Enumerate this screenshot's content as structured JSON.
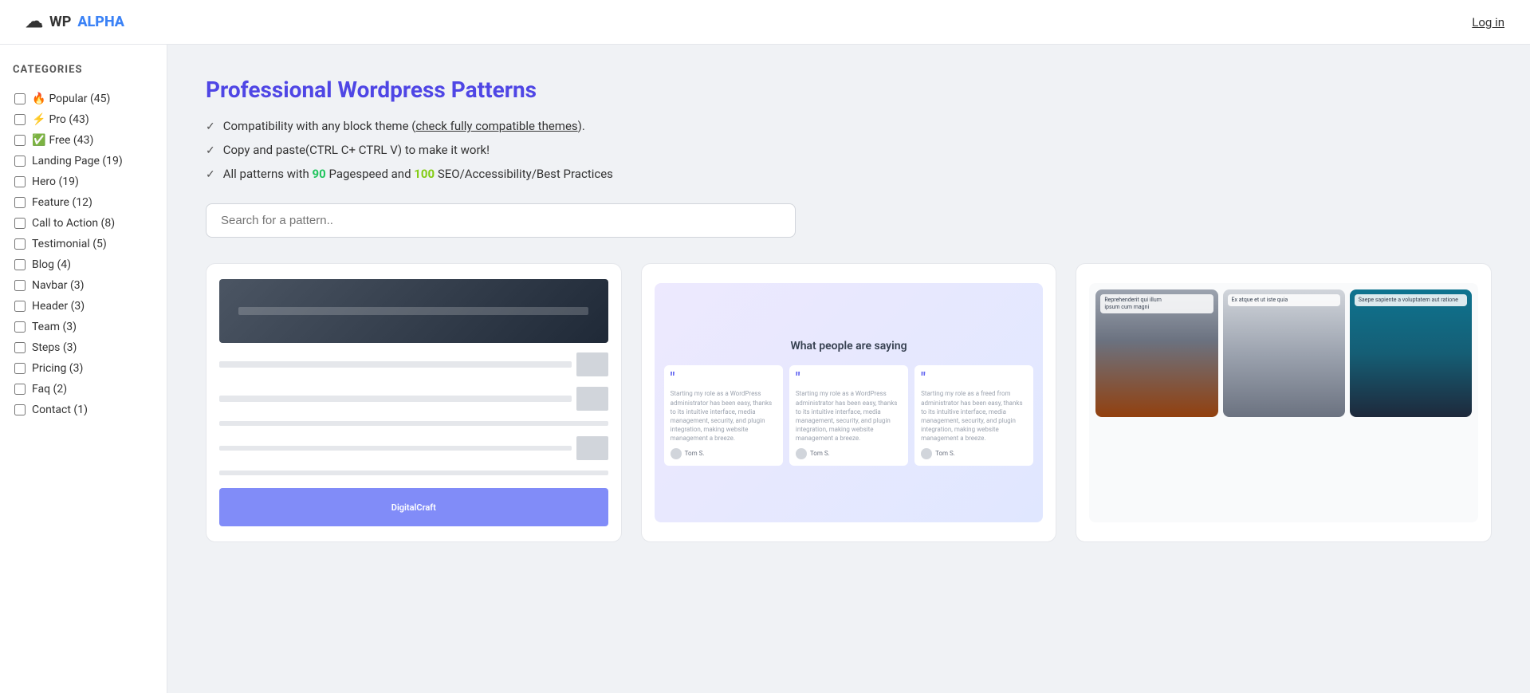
{
  "nav": {
    "logo_wp": "WP",
    "logo_alpha": "ALPHA",
    "login_label": "Log in"
  },
  "sidebar": {
    "title": "CATEGORIES",
    "items": [
      {
        "id": "popular",
        "icon": "🔥",
        "label": "Popular (45)",
        "checked": false
      },
      {
        "id": "pro",
        "icon": "⚡",
        "label": "Pro (43)",
        "checked": false
      },
      {
        "id": "free",
        "icon": "✅",
        "label": "Free (43)",
        "checked": false
      },
      {
        "id": "landing-page",
        "icon": "",
        "label": "Landing Page (19)",
        "checked": false
      },
      {
        "id": "hero",
        "icon": "",
        "label": "Hero (19)",
        "checked": false
      },
      {
        "id": "feature",
        "icon": "",
        "label": "Feature (12)",
        "checked": false
      },
      {
        "id": "cta",
        "icon": "",
        "label": "Call to Action (8)",
        "checked": false
      },
      {
        "id": "testimonial",
        "icon": "",
        "label": "Testimonial (5)",
        "checked": false
      },
      {
        "id": "blog",
        "icon": "",
        "label": "Blog (4)",
        "checked": false
      },
      {
        "id": "navbar",
        "icon": "",
        "label": "Navbar (3)",
        "checked": false
      },
      {
        "id": "header",
        "icon": "",
        "label": "Header (3)",
        "checked": false
      },
      {
        "id": "team",
        "icon": "",
        "label": "Team (3)",
        "checked": false
      },
      {
        "id": "steps",
        "icon": "",
        "label": "Steps (3)",
        "checked": false
      },
      {
        "id": "pricing",
        "icon": "",
        "label": "Pricing (3)",
        "checked": false
      },
      {
        "id": "faq",
        "icon": "",
        "label": "Faq (2)",
        "checked": false
      },
      {
        "id": "contact",
        "icon": "",
        "label": "Contact (1)",
        "checked": false
      }
    ]
  },
  "main": {
    "title": "Professional Wordpress Patterns",
    "features": [
      {
        "id": "compat",
        "text_before": "Compatibility with any block theme (",
        "link_text": "check fully compatible themes",
        "text_after": ")."
      },
      {
        "id": "copy",
        "text": "Copy and paste(CTRL C+ CTRL V) to make it work!"
      },
      {
        "id": "pagespeed",
        "text_before": "All patterns with ",
        "score1": "90",
        "text_middle": " Pagespeed and ",
        "score2": "100",
        "text_after": " SEO/Accessibility/Best Practices"
      }
    ],
    "search_placeholder": "Search for a pattern..",
    "cards": [
      {
        "id": "card-landing",
        "type": "landing-preview",
        "bottom_label": "DigitalCraft"
      },
      {
        "id": "card-testimonial",
        "type": "testimonial-preview",
        "title": "What people are saying",
        "quotes": [
          {
            "text": "Starting my role as a WordPress administrator has been easy, thanks to its intuitive interface, media management, security, and plugin integration, making website management a breeze.",
            "author": "Tom S."
          },
          {
            "text": "Starting my role as a WordPress administrator has been easy, thanks to its intuitive interface, media management, security, and plugin integration, making website management a breeze.",
            "author": "Tom S."
          },
          {
            "text": "Starting my role as a freed from administrator has been easy, thanks to its intuitive interface, media management, security, and plugin integration, making website management a breeze.",
            "author": "Tom S."
          }
        ]
      },
      {
        "id": "card-hero",
        "type": "hero-images-preview",
        "images": [
          {
            "label1": "Reprehenderit qui illum",
            "label2": "ipsum cum magni"
          },
          {
            "label1": "Ex atque et ut iste quia"
          },
          {
            "label1": "Saepe sapiente a voluptatem aut ratione"
          }
        ]
      }
    ]
  }
}
